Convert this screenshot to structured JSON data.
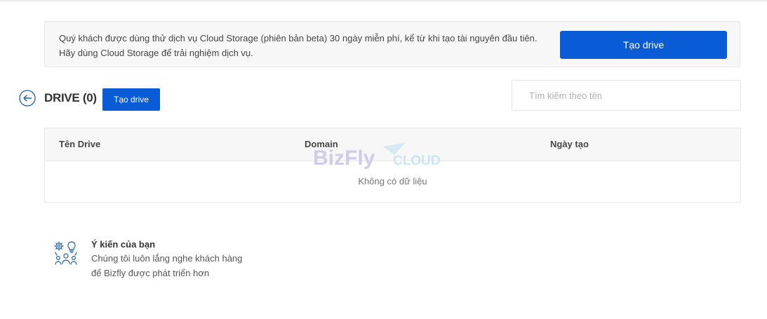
{
  "notice": {
    "text": "Quý khách được dùng thử dịch vụ Cloud Storage (phiên bản beta) 30 ngày miễn phí, kể từ khi tạo tài nguyên đầu tiên. Hãy dùng Cloud Storage để trải nghiệm dịch vụ.",
    "button_label": "Tạo drive"
  },
  "header": {
    "back_icon": "arrow-left-circle-icon",
    "title": "DRIVE (0)",
    "create_button_label": "Tạo drive"
  },
  "search": {
    "placeholder": "Tìm kiếm theo tên",
    "value": ""
  },
  "table": {
    "columns": [
      "Tên Drive",
      "Domain",
      "Ngày tạo"
    ],
    "rows": [],
    "empty_text": "Không có dữ liệu",
    "watermark_text_1": "BizFly",
    "watermark_text_2": "CLOUD"
  },
  "feedback": {
    "icon": "feedback-people-gear-bulb-icon",
    "title": "Ý kiến của bạn",
    "line1": "Chúng tôi luôn lắng nghe khách hàng",
    "line2": "để Bizfly được phát triển hơn"
  },
  "colors": {
    "primary": "#0a5bd6",
    "icon_blue": "#1f5fa8",
    "panel_bg": "#f7f7f7",
    "border": "#e8e8e8"
  }
}
